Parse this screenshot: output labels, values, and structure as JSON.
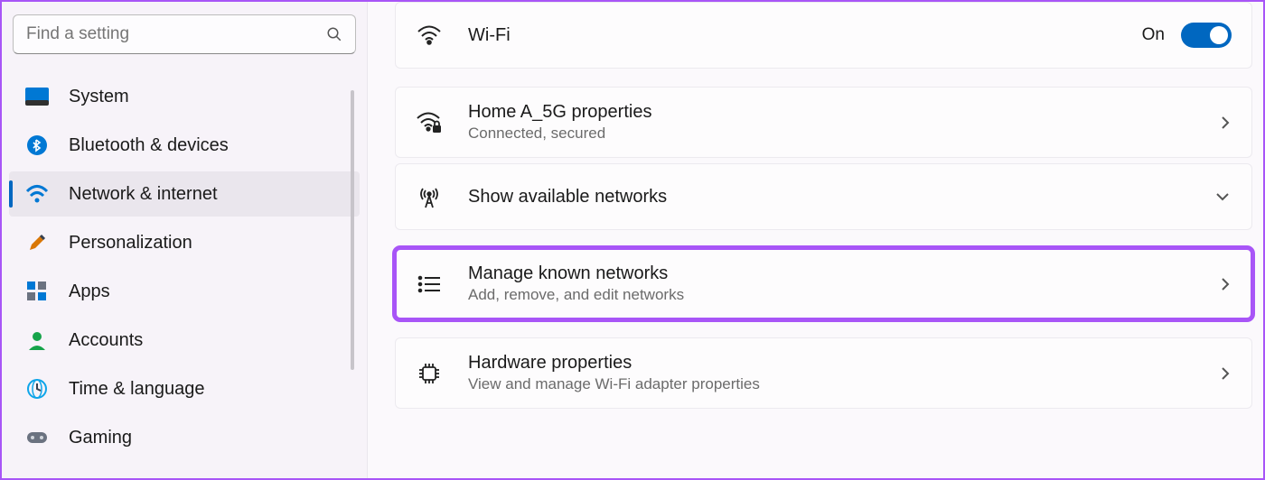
{
  "search": {
    "placeholder": "Find a setting"
  },
  "sidebar": {
    "items": [
      {
        "label": "System"
      },
      {
        "label": "Bluetooth & devices"
      },
      {
        "label": "Network & internet"
      },
      {
        "label": "Personalization"
      },
      {
        "label": "Apps"
      },
      {
        "label": "Accounts"
      },
      {
        "label": "Time & language"
      },
      {
        "label": "Gaming"
      }
    ]
  },
  "main": {
    "wifi": {
      "title": "Wi-Fi",
      "toggle_state": "On"
    },
    "props": {
      "title": "Home A_5G properties",
      "sub": "Connected, secured"
    },
    "available": {
      "title": "Show available networks"
    },
    "manage": {
      "title": "Manage known networks",
      "sub": "Add, remove, and edit networks"
    },
    "hardware": {
      "title": "Hardware properties",
      "sub": "View and manage Wi-Fi adapter properties"
    }
  }
}
